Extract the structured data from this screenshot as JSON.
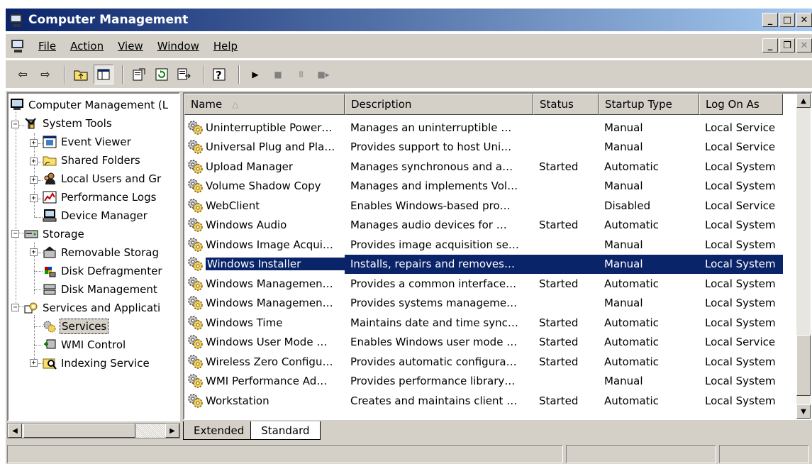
{
  "window": {
    "title": "Computer Management",
    "minimize_label": "_",
    "maximize_label": "□",
    "close_label": "✕"
  },
  "menu": {
    "items": [
      {
        "label": "File"
      },
      {
        "label": "Action"
      },
      {
        "label": "View"
      },
      {
        "label": "Window"
      },
      {
        "label": "Help"
      }
    ]
  },
  "tree": {
    "items": [
      {
        "label": "Computer Management (L",
        "icon": "computer-icon"
      },
      {
        "label": "System Tools",
        "icon": "tools-icon"
      },
      {
        "label": "Event Viewer",
        "icon": "event-viewer-icon"
      },
      {
        "label": "Shared Folders",
        "icon": "folder-icon"
      },
      {
        "label": "Local Users and Gr",
        "icon": "users-icon"
      },
      {
        "label": "Performance Logs",
        "icon": "performance-icon"
      },
      {
        "label": "Device Manager",
        "icon": "device-manager-icon"
      },
      {
        "label": "Storage",
        "icon": "storage-icon"
      },
      {
        "label": "Removable Storag",
        "icon": "removable-storage-icon"
      },
      {
        "label": "Disk Defragmenter",
        "icon": "defrag-icon"
      },
      {
        "label": "Disk Management",
        "icon": "disk-management-icon"
      },
      {
        "label": "Services and Applicati",
        "icon": "services-apps-icon"
      },
      {
        "label": "Services",
        "icon": "services-gear-icon"
      },
      {
        "label": "WMI Control",
        "icon": "wmi-icon"
      },
      {
        "label": "Indexing Service",
        "icon": "indexing-icon"
      }
    ]
  },
  "list": {
    "columns": [
      "Name",
      "Description",
      "Status",
      "Startup Type",
      "Log On As"
    ],
    "rows": [
      {
        "name": "Uninterruptible Power…",
        "description": "Manages an uninterruptible …",
        "status": "",
        "startup": "Manual",
        "logon": "Local Service"
      },
      {
        "name": "Universal Plug and Pla…",
        "description": "Provides support to host Uni…",
        "status": "",
        "startup": "Manual",
        "logon": "Local Service"
      },
      {
        "name": "Upload Manager",
        "description": "Manages synchronous and a…",
        "status": "Started",
        "startup": "Automatic",
        "logon": "Local System"
      },
      {
        "name": "Volume Shadow Copy",
        "description": "Manages and implements Vol…",
        "status": "",
        "startup": "Manual",
        "logon": "Local System"
      },
      {
        "name": "WebClient",
        "description": "Enables Windows-based pro…",
        "status": "",
        "startup": "Disabled",
        "logon": "Local Service"
      },
      {
        "name": "Windows Audio",
        "description": "Manages audio devices for …",
        "status": "Started",
        "startup": "Automatic",
        "logon": "Local System"
      },
      {
        "name": "Windows Image Acqui…",
        "description": "Provides image acquisition se…",
        "status": "",
        "startup": "Manual",
        "logon": "Local System"
      },
      {
        "name": "Windows Installer",
        "description": "Installs, repairs and removes…",
        "status": "",
        "startup": "Manual",
        "logon": "Local System"
      },
      {
        "name": "Windows Managemen…",
        "description": "Provides a common interface…",
        "status": "Started",
        "startup": "Automatic",
        "logon": "Local System"
      },
      {
        "name": "Windows Managemen…",
        "description": "Provides systems manageme…",
        "status": "",
        "startup": "Manual",
        "logon": "Local System"
      },
      {
        "name": "Windows Time",
        "description": "Maintains date and time sync…",
        "status": "Started",
        "startup": "Automatic",
        "logon": "Local System"
      },
      {
        "name": "Windows User Mode …",
        "description": "Enables Windows user mode …",
        "status": "Started",
        "startup": "Automatic",
        "logon": "Local Service"
      },
      {
        "name": "Wireless Zero Configu…",
        "description": "Provides automatic configura…",
        "status": "Started",
        "startup": "Automatic",
        "logon": "Local System"
      },
      {
        "name": "WMI Performance Ad…",
        "description": "Provides performance library…",
        "status": "",
        "startup": "Manual",
        "logon": "Local System"
      },
      {
        "name": "Workstation",
        "description": "Creates and maintains client …",
        "status": "Started",
        "startup": "Automatic",
        "logon": "Local System"
      }
    ],
    "selected_row": "Windows Installer"
  },
  "tabs": [
    {
      "label": "Extended"
    },
    {
      "label": "Standard"
    }
  ],
  "colors": {
    "title_gradient_start": "#0a246a",
    "title_gradient_end": "#a6caf0",
    "selection": "#0a246a",
    "chrome": "#d4d0c8"
  }
}
